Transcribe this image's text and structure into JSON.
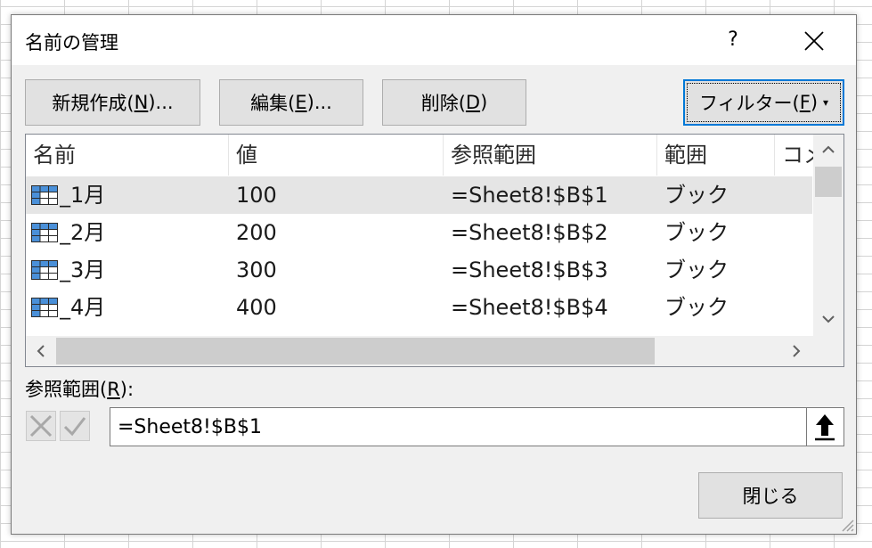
{
  "dialog": {
    "title": "名前の管理",
    "help": "?"
  },
  "buttons": {
    "new": {
      "pre": "新規作成(",
      "key": "N",
      "post": ")..."
    },
    "edit": {
      "pre": "編集(",
      "key": "E",
      "post": ")..."
    },
    "delete": {
      "pre": "削除(",
      "key": "D",
      "post": ")"
    },
    "filter": {
      "pre": "フィルター(",
      "key": "F",
      "post": ")",
      "arrow": "▾"
    },
    "close": "閉じる"
  },
  "list": {
    "columns": [
      "名前",
      "値",
      "参照範囲",
      "範囲",
      "コメント"
    ],
    "rows": [
      {
        "name": "_1月",
        "value": "100",
        "ref": "=Sheet8!$B$1",
        "scope": "ブック",
        "selected": true
      },
      {
        "name": "_2月",
        "value": "200",
        "ref": "=Sheet8!$B$2",
        "scope": "ブック",
        "selected": false
      },
      {
        "name": "_3月",
        "value": "300",
        "ref": "=Sheet8!$B$3",
        "scope": "ブック",
        "selected": false
      },
      {
        "name": "_4月",
        "value": "400",
        "ref": "=Sheet8!$B$4",
        "scope": "ブック",
        "selected": false
      }
    ]
  },
  "reference": {
    "label_pre": "参照範囲(",
    "label_key": "R",
    "label_post": "):",
    "value": "=Sheet8!$B$1"
  },
  "colors": {
    "accent": "#0078d7",
    "selected_row": "#e5e5e5",
    "dialog_bg": "#f0f0f0"
  }
}
